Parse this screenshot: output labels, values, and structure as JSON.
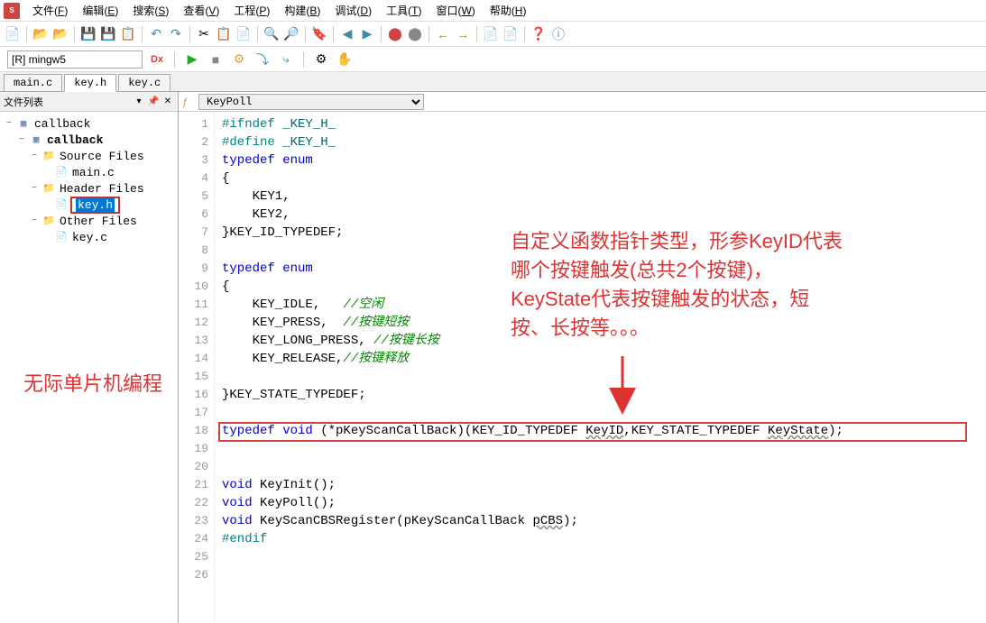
{
  "menu": {
    "items": [
      {
        "label": "文件",
        "key": "F"
      },
      {
        "label": "编辑",
        "key": "E"
      },
      {
        "label": "搜索",
        "key": "S"
      },
      {
        "label": "查看",
        "key": "V"
      },
      {
        "label": "工程",
        "key": "P"
      },
      {
        "label": "构建",
        "key": "B"
      },
      {
        "label": "调试",
        "key": "D"
      },
      {
        "label": "工具",
        "key": "T"
      },
      {
        "label": "窗口",
        "key": "W"
      },
      {
        "label": "帮助",
        "key": "H"
      }
    ]
  },
  "target": "[R] mingw5",
  "tabs": [
    {
      "label": "main.c",
      "active": false
    },
    {
      "label": "key.h",
      "active": true
    },
    {
      "label": "key.c",
      "active": false
    }
  ],
  "sidebar": {
    "title": "文件列表",
    "tree": [
      {
        "level": 0,
        "icon": "proj",
        "label": "callback",
        "toggle": "−"
      },
      {
        "level": 1,
        "icon": "proj",
        "label": "callback",
        "bold": true,
        "toggle": "−"
      },
      {
        "level": 2,
        "icon": "folder",
        "label": "Source Files",
        "toggle": "−"
      },
      {
        "level": 3,
        "icon": "file",
        "label": "main.c"
      },
      {
        "level": 2,
        "icon": "folder",
        "label": "Header Files",
        "toggle": "−"
      },
      {
        "level": 3,
        "icon": "file",
        "label": "key.h",
        "selected": true,
        "boxed": true
      },
      {
        "level": 2,
        "icon": "folder",
        "label": "Other Files",
        "toggle": "−"
      },
      {
        "level": 3,
        "icon": "file",
        "label": "key.c"
      }
    ]
  },
  "symbol": {
    "current": "KeyPoll"
  },
  "code": {
    "lines": [
      {
        "n": 1,
        "tokens": [
          {
            "c": "pp",
            "t": "#ifndef"
          },
          {
            "t": " "
          },
          {
            "c": "macro",
            "t": "_KEY_H_"
          }
        ]
      },
      {
        "n": 2,
        "tokens": [
          {
            "c": "pp",
            "t": "#define"
          },
          {
            "t": " "
          },
          {
            "c": "macro",
            "t": "_KEY_H_"
          }
        ]
      },
      {
        "n": 3,
        "tokens": [
          {
            "c": "kw",
            "t": "typedef"
          },
          {
            "t": " "
          },
          {
            "c": "kw",
            "t": "enum"
          }
        ]
      },
      {
        "n": 4,
        "tokens": [
          {
            "t": "{"
          }
        ]
      },
      {
        "n": 5,
        "tokens": [
          {
            "t": "    KEY1,"
          }
        ]
      },
      {
        "n": 6,
        "tokens": [
          {
            "t": "    KEY2,"
          }
        ]
      },
      {
        "n": 7,
        "tokens": [
          {
            "t": "}KEY_ID_TYPEDEF;"
          }
        ]
      },
      {
        "n": 8,
        "tokens": []
      },
      {
        "n": 9,
        "tokens": [
          {
            "c": "kw",
            "t": "typedef"
          },
          {
            "t": " "
          },
          {
            "c": "kw",
            "t": "enum"
          }
        ]
      },
      {
        "n": 10,
        "tokens": [
          {
            "t": "{"
          }
        ]
      },
      {
        "n": 11,
        "tokens": [
          {
            "t": "    KEY_IDLE,   "
          },
          {
            "c": "cmt",
            "t": "//空闲"
          }
        ]
      },
      {
        "n": 12,
        "tokens": [
          {
            "t": "    KEY_PRESS,  "
          },
          {
            "c": "cmt",
            "t": "//按键短按"
          }
        ]
      },
      {
        "n": 13,
        "tokens": [
          {
            "t": "    KEY_LONG_PRESS, "
          },
          {
            "c": "cmt",
            "t": "//按键长按"
          }
        ]
      },
      {
        "n": 14,
        "tokens": [
          {
            "t": "    KEY_RELEASE,"
          },
          {
            "c": "cmt",
            "t": "//按键释放"
          }
        ]
      },
      {
        "n": 15,
        "tokens": []
      },
      {
        "n": 16,
        "tokens": [
          {
            "t": "}KEY_STATE_TYPEDEF;"
          }
        ]
      },
      {
        "n": 17,
        "tokens": []
      },
      {
        "n": 18,
        "tokens": [
          {
            "c": "kw",
            "t": "typedef"
          },
          {
            "t": " "
          },
          {
            "c": "kw",
            "t": "void"
          },
          {
            "t": " (*pKeyScanCallBack)(KEY_ID_TYPEDEF "
          },
          {
            "c": "param",
            "t": "KeyID"
          },
          {
            "t": ",KEY_STATE_TYPEDEF "
          },
          {
            "c": "param",
            "t": "KeyState"
          },
          {
            "t": ");"
          }
        ]
      },
      {
        "n": 19,
        "tokens": []
      },
      {
        "n": 20,
        "tokens": []
      },
      {
        "n": 21,
        "tokens": [
          {
            "c": "kw",
            "t": "void"
          },
          {
            "t": " KeyInit();"
          }
        ]
      },
      {
        "n": 22,
        "tokens": [
          {
            "c": "kw",
            "t": "void"
          },
          {
            "t": " KeyPoll();"
          }
        ]
      },
      {
        "n": 23,
        "tokens": [
          {
            "c": "kw",
            "t": "void"
          },
          {
            "t": " KeyScanCBSRegister(pKeyScanCallBack "
          },
          {
            "c": "param",
            "t": "pCBS"
          },
          {
            "t": ");"
          }
        ]
      },
      {
        "n": 24,
        "tokens": [
          {
            "c": "pp",
            "t": "#endif"
          }
        ]
      },
      {
        "n": 25,
        "tokens": []
      },
      {
        "n": 26,
        "tokens": []
      }
    ]
  },
  "annotations": {
    "left": "无际单片机编程",
    "right_lines": [
      "自定义函数指针类型，形参KeyID代表",
      "哪个按键触发(总共2个按键)，",
      "KeyState代表按键触发的状态，短",
      "按、长按等。。。"
    ]
  }
}
